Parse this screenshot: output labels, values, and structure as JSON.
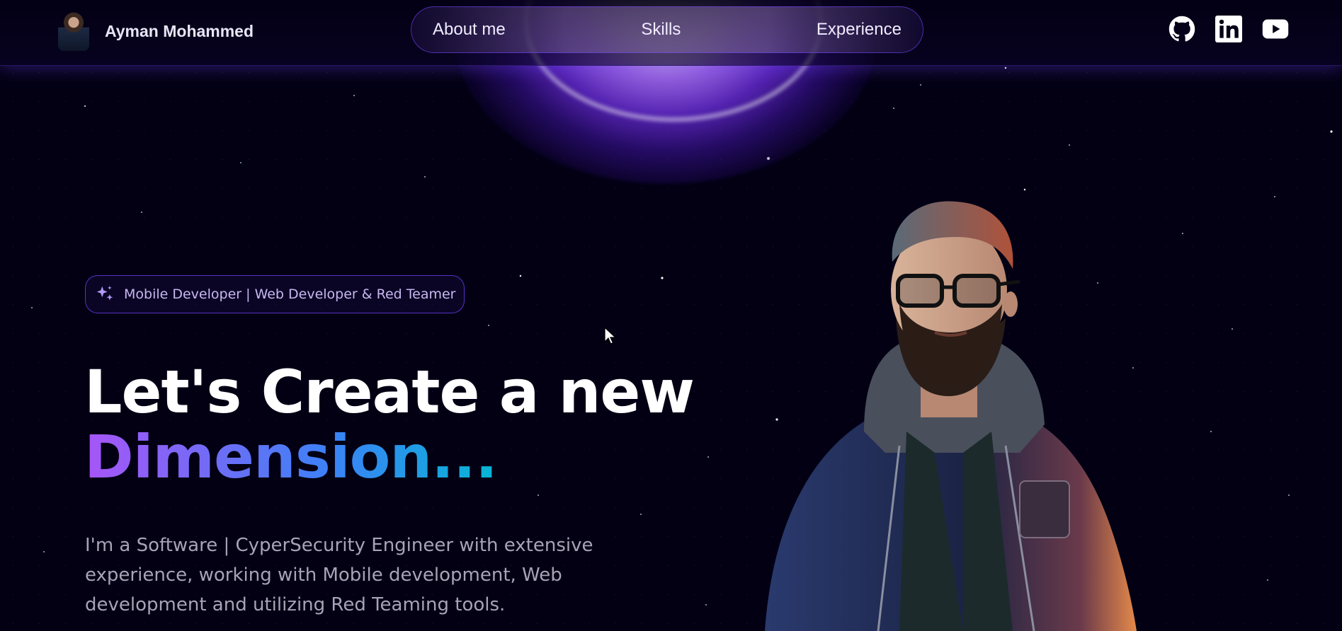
{
  "header": {
    "brand_name": "Ayman Mohammed",
    "nav_items": [
      {
        "label": "About me"
      },
      {
        "label": "Skills"
      },
      {
        "label": "Experience"
      }
    ],
    "social_icons": [
      "github-icon",
      "linkedin-icon",
      "youtube-icon"
    ]
  },
  "hero": {
    "badge_text": "Mobile Developer | Web Developer & Red Teamer",
    "headline_line1": "Let's Create a new",
    "headline_accent": "Dimension...",
    "intro": "I'm a Software | CyperSecurity Engineer with extensive experience, working with Mobile development, Web development and utilizing Red Teaming tools."
  },
  "colors": {
    "background": "#030014",
    "accent_purple": "#7042f8",
    "gradient_start": "#a855f7",
    "gradient_end": "#06b6d4"
  }
}
